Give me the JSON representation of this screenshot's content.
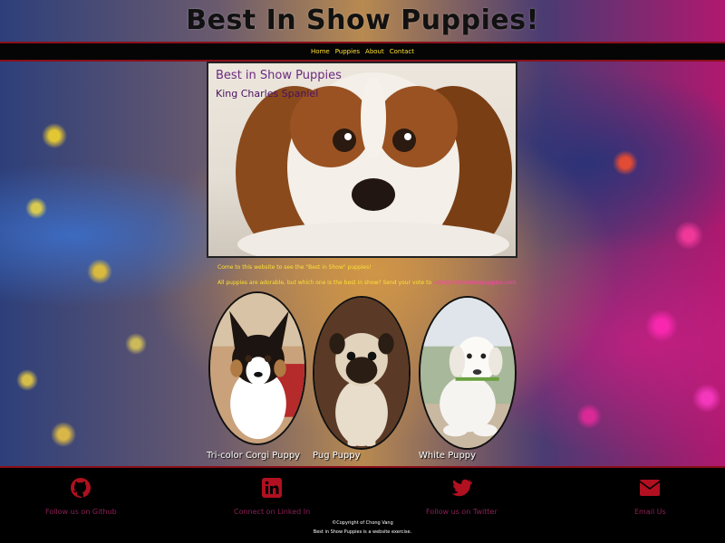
{
  "header": {
    "title": "Best In Show Puppies!"
  },
  "nav": {
    "items": [
      {
        "label": "Home"
      },
      {
        "label": "Puppies"
      },
      {
        "label": "About"
      },
      {
        "label": "Contact"
      }
    ]
  },
  "hero": {
    "title": "Best in Show Puppies",
    "subtitle": "King Charles Spaniel"
  },
  "intro": {
    "line1": "Come to this website to see the \"Best in Show\" puppies!",
    "line2_prefix": "All puppies are adorable, but which one is the best in show? Send your vote to ",
    "vote_email": "vote@bestinshowpuppies.com"
  },
  "puppies": [
    {
      "caption": "Tri-color Corgi Puppy"
    },
    {
      "caption": "Pug Puppy"
    },
    {
      "caption": "White Puppy"
    }
  ],
  "footer": {
    "social": [
      {
        "label": "Follow us on Github",
        "icon": "github-icon"
      },
      {
        "label": "Connect on Linked In",
        "icon": "linkedin-icon"
      },
      {
        "label": "Follow us on Twitter",
        "icon": "twitter-icon"
      },
      {
        "label": "Email Us",
        "icon": "email-icon"
      }
    ],
    "copyright_line1": "©Copyright of Chong Vang",
    "copyright_line2": "Best in Show Puppies is a website exercise."
  },
  "colors": {
    "nav_text": "#ffe033",
    "footer_icon": "#b01020",
    "footer_label": "#8c1f55",
    "hero_title": "#6b2a7f"
  }
}
